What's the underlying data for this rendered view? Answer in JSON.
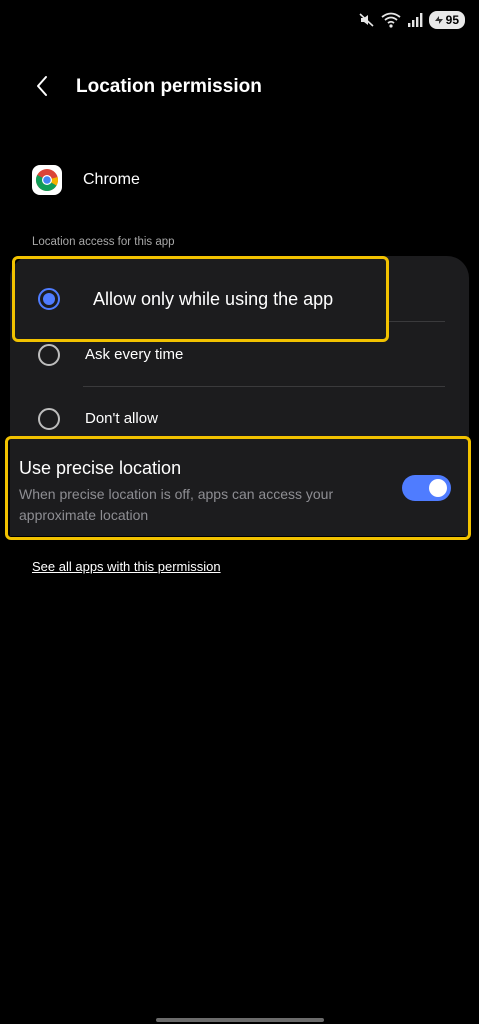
{
  "status_bar": {
    "battery_level": "95",
    "icons": [
      "mute-icon",
      "wifi-icon",
      "signal-icon",
      "battery-icon"
    ]
  },
  "header": {
    "title": "Location permission",
    "back_icon": "chevron-left-icon"
  },
  "app": {
    "name": "Chrome",
    "icon": "chrome-icon"
  },
  "section_label": "Location access for this app",
  "options": [
    {
      "label": "Allow only while using the app",
      "selected": true
    },
    {
      "label": "Ask every time",
      "selected": false
    },
    {
      "label": "Don't allow",
      "selected": false
    }
  ],
  "precise_location": {
    "title": "Use precise location",
    "description": "When precise location is off, apps can access your approximate location",
    "enabled": true
  },
  "see_all_link": "See all apps with this permission",
  "colors": {
    "background": "#000000",
    "card": "#1c1c1e",
    "accent": "#4f7cff",
    "highlight": "#f2c200"
  }
}
